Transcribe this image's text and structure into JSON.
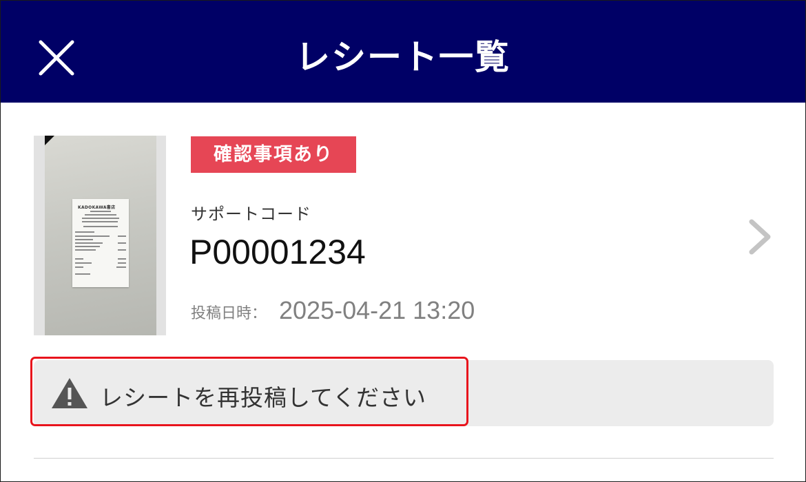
{
  "header": {
    "title": "レシート一覧",
    "close_icon": "close-icon",
    "background": "#000066"
  },
  "receipt_item": {
    "thumbnail": {
      "receipt_logo": "KADOKAWA書店"
    },
    "status_badge": {
      "label": "確認事項あり",
      "color": "#e64655"
    },
    "support_code_label": "サポートコード",
    "support_code": "P00001234",
    "posted_label": "投稿日時：",
    "posted_at": "2025-04-21 13:20",
    "chevron_icon": "chevron-right-icon",
    "alert": {
      "icon": "warning-icon",
      "message": "レシートを再投稿してください",
      "border_color": "#e8141c"
    }
  }
}
